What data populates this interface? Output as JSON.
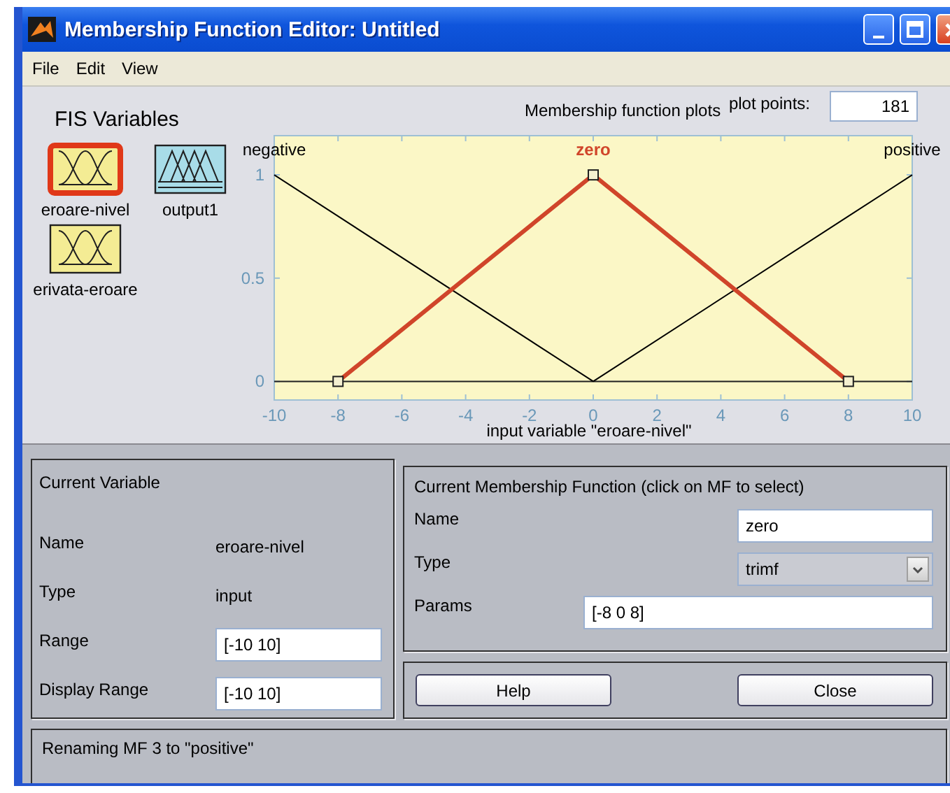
{
  "window": {
    "title": "Membership Function Editor: Untitled"
  },
  "menu": [
    "File",
    "Edit",
    "View"
  ],
  "fis_variables": {
    "heading": "FIS Variables",
    "items": [
      {
        "name": "eroare-nivel",
        "kind": "input",
        "selected": true
      },
      {
        "name": "output1",
        "kind": "output",
        "selected": false
      },
      {
        "name": "erivata-eroare",
        "kind": "input",
        "selected": false
      }
    ]
  },
  "plot": {
    "title": "Membership function plots",
    "plot_points_label": "plot points:",
    "plot_points": "181",
    "chart_data": {
      "type": "line",
      "xlabel": "input variable \"eroare-nivel\"",
      "x": [
        -10,
        -8,
        0,
        8,
        10
      ],
      "xlim": [
        -10,
        10
      ],
      "ylim": [
        -0.09,
        1.19
      ],
      "xticks": [
        -10,
        -8,
        -6,
        -4,
        -2,
        0,
        2,
        4,
        6,
        8,
        10
      ],
      "yticks": [
        0,
        0.5,
        1
      ],
      "series": [
        {
          "name": "negative",
          "color": "#000000",
          "marker": "none",
          "values": [
            1,
            0.8,
            0,
            null,
            null
          ]
        },
        {
          "name": "zero",
          "color": "#d0452a",
          "marker": "square",
          "values": [
            null,
            0,
            1,
            0,
            null
          ]
        },
        {
          "name": "positive",
          "color": "#000000",
          "marker": "none",
          "values": [
            null,
            null,
            0,
            0.8,
            1
          ]
        }
      ]
    },
    "membership_functions": [
      {
        "selected": false
      },
      {
        "selected": true
      },
      {
        "selected": false
      }
    ]
  },
  "current_variable": {
    "heading": "Current Variable",
    "fields": [
      {
        "label": "Name",
        "value": "eroare-nivel",
        "kind": "text"
      },
      {
        "label": "Type",
        "value": "input",
        "kind": "text"
      },
      {
        "label": "Range",
        "value": "[-10 10]",
        "kind": "input"
      },
      {
        "label": "Display Range",
        "value": "[-10 10]",
        "kind": "input"
      }
    ]
  },
  "current_mf": {
    "heading": "Current Membership Function (click on MF to select)",
    "fields": [
      {
        "label": "Name",
        "value": "zero",
        "kind": "input"
      },
      {
        "label": "Type",
        "value": "trimf",
        "kind": "dropdown"
      },
      {
        "label": "Params",
        "value": "[-8 0 8]",
        "kind": "wide-input"
      }
    ]
  },
  "buttons": [
    "Help",
    "Close"
  ],
  "status": "Renaming MF 3 to \"positive\""
}
